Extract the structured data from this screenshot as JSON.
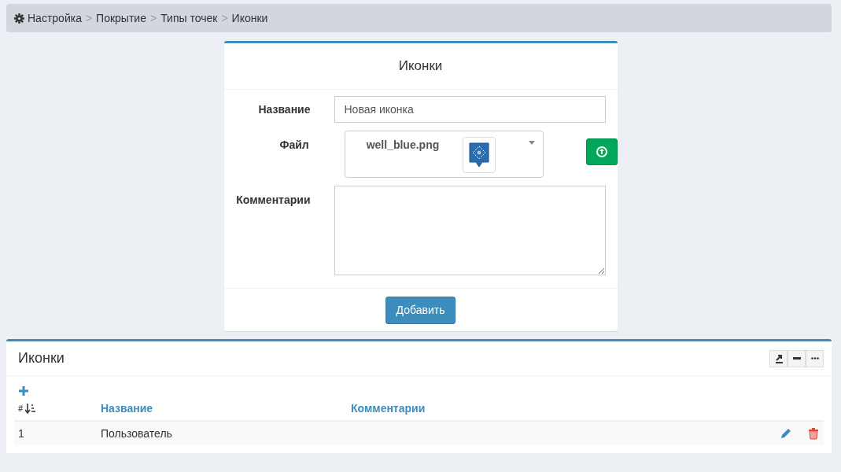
{
  "breadcrumb": [
    "Настройка",
    "Покрытие",
    "Типы точек",
    "Иконки"
  ],
  "breadcrumb_separator": ">",
  "form": {
    "title": "Иконки",
    "name_label": "Название",
    "name_value": "Новая иконка",
    "file_label": "Файл",
    "file_name": "well_blue.png",
    "comment_label": "Комментарии",
    "submit": "Добавить"
  },
  "table_panel": {
    "title": "Иконки",
    "columns": [
      "#",
      "Название",
      "Комментарии"
    ],
    "rows": [
      {
        "cells": [
          "1",
          "Пользователь",
          ""
        ]
      }
    ]
  }
}
